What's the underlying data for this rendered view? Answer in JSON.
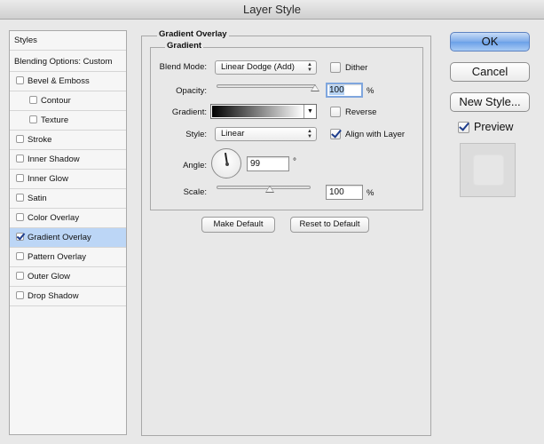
{
  "window": {
    "title": "Layer Style"
  },
  "styles_list": {
    "header": "Styles",
    "blending": "Blending Options: Custom",
    "items": [
      {
        "label": "Bevel & Emboss",
        "checked": false
      },
      {
        "label": "Contour",
        "checked": false,
        "sub": true
      },
      {
        "label": "Texture",
        "checked": false,
        "sub": true
      },
      {
        "label": "Stroke",
        "checked": false
      },
      {
        "label": "Inner Shadow",
        "checked": false
      },
      {
        "label": "Inner Glow",
        "checked": false
      },
      {
        "label": "Satin",
        "checked": false
      },
      {
        "label": "Color Overlay",
        "checked": false
      },
      {
        "label": "Gradient Overlay",
        "checked": true,
        "selected": true
      },
      {
        "label": "Pattern Overlay",
        "checked": false
      },
      {
        "label": "Outer Glow",
        "checked": false
      },
      {
        "label": "Drop Shadow",
        "checked": false
      }
    ]
  },
  "panel": {
    "title": "Gradient Overlay",
    "group_title": "Gradient",
    "blend_mode_label": "Blend Mode:",
    "blend_mode_value": "Linear Dodge (Add)",
    "dither_label": "Dither",
    "dither_checked": false,
    "opacity_label": "Opacity:",
    "opacity_value": "100",
    "opacity_unit": "%",
    "opacity_level": 1.0,
    "gradient_label": "Gradient:",
    "gradient_colors": [
      "#000000",
      "#ffffff"
    ],
    "reverse_label": "Reverse",
    "reverse_checked": false,
    "style_label": "Style:",
    "style_value": "Linear",
    "align_label": "Align with Layer",
    "align_checked": true,
    "angle_label": "Angle:",
    "angle_value": "99",
    "angle_unit": "°",
    "scale_label": "Scale:",
    "scale_value": "100",
    "scale_unit": "%",
    "scale_level": 0.45,
    "make_default": "Make Default",
    "reset_default": "Reset to Default"
  },
  "actions": {
    "ok": "OK",
    "cancel": "Cancel",
    "new_style": "New Style...",
    "preview_label": "Preview",
    "preview_checked": true
  },
  "colors": {
    "selection": "#bcd6f6",
    "accent": "#7cabea"
  }
}
